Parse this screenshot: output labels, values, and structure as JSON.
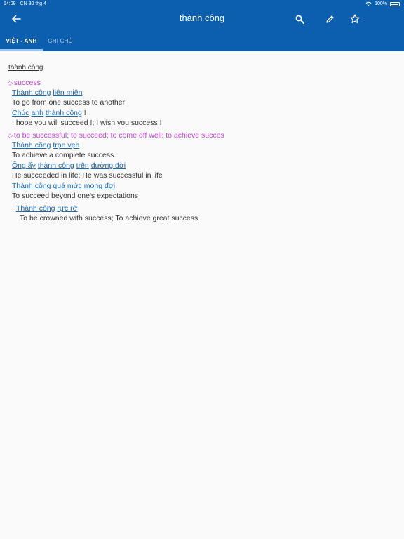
{
  "status": {
    "time": "14:09",
    "date": "CN 30 thg 4",
    "battery": "100%"
  },
  "header": {
    "title": "thành công",
    "icons": [
      "back-arrow-icon",
      "search-icon",
      "pencil-icon",
      "star-icon"
    ]
  },
  "tabs": [
    {
      "label": "VIỆT - ANH"
    },
    {
      "label": "GHI CHÚ"
    }
  ],
  "entry": {
    "headword": "thành công",
    "senses": [
      {
        "meaning": "success",
        "examples": [
          {
            "phrase": [
              "Thành công",
              "liên miên"
            ],
            "translation": "To go from one success to another"
          },
          {
            "phrase": [
              "Chúc",
              "anh",
              "thành công"
            ],
            "suffix": "!",
            "translation": "I hope you will succeed !; I wish you success !"
          }
        ]
      },
      {
        "meaning": "to be successful; to succeed; to come off well; to achieve succes",
        "examples": [
          {
            "phrase": [
              "Thành công",
              "trọn vẹn"
            ],
            "translation": "To achieve a complete success"
          },
          {
            "phrase": [
              "Ông ấy",
              "thành công",
              "trên",
              "đường đời"
            ],
            "translation": "He succeeded in life; He was successful in life"
          },
          {
            "phrase": [
              "Thành công",
              "quá",
              "mức",
              "mong đợi"
            ],
            "translation": "To succeed beyond one's expectations"
          }
        ],
        "idiom": {
          "phrase": [
            "Thành công",
            "rực rỡ"
          ],
          "translation": "To be crowned with success; To achieve great success"
        }
      }
    ]
  },
  "colors": {
    "header_bg": "#0b5fae",
    "sense": "#c542d6",
    "link": "#1b69b4"
  }
}
